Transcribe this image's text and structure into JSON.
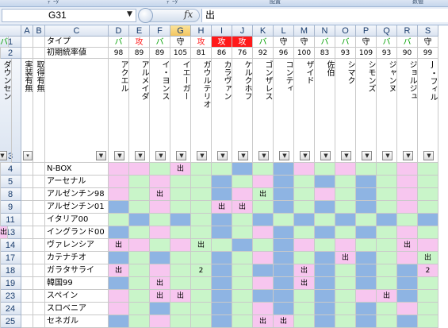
{
  "colors": {
    "red": "#ff1a1a",
    "orange": "#ff7a00",
    "green": "#00a000",
    "pink": "#f7c6ef",
    "lgreen": "#c9f5c9",
    "blue": "#8eb4e3"
  },
  "ribbon": {
    "labels": [
      "ﾃﾞｰﾀ",
      "ﾃﾞｰﾀ",
      "配置",
      "数値"
    ]
  },
  "formula_bar": {
    "name_box": "G31",
    "fx": "fx",
    "value": "出"
  },
  "columns": [
    "A",
    "B",
    "C",
    "D",
    "E",
    "F",
    "G",
    "H",
    "I",
    "J",
    "K",
    "L",
    "M",
    "N",
    "O",
    "P",
    "Q",
    "R",
    "S"
  ],
  "selected_column": "G",
  "header": {
    "row1_label": "タイプ",
    "row2_label": "初期統率値",
    "a3_label": "実装有無",
    "b3_label": "取得有無",
    "players": [
      {
        "name": "アクエル",
        "type": "バ",
        "val": "98",
        "style": "green"
      },
      {
        "name": "アルメイダ",
        "type": "攻",
        "val": "89",
        "style": "red"
      },
      {
        "name": "イ・ヨンス",
        "type": "バ",
        "val": "89",
        "style": "green"
      },
      {
        "name": "イエーガー",
        "type": "守",
        "val": "105",
        "style": "plain"
      },
      {
        "name": "ガウルテリオ",
        "type": "攻",
        "val": "81",
        "style": "red"
      },
      {
        "name": "カラヴァン",
        "type": "攻",
        "val": "86",
        "style": "redbg"
      },
      {
        "name": "ケルクホフ",
        "type": "攻",
        "val": "76",
        "style": "redbg"
      },
      {
        "name": "ゴンザレス",
        "type": "バ",
        "val": "92",
        "style": "green"
      },
      {
        "name": "コンティ",
        "type": "守",
        "val": "96",
        "style": "plain"
      },
      {
        "name": "ザイド",
        "type": "守",
        "val": "100",
        "style": "plain"
      },
      {
        "name": "佐伯",
        "type": "バ",
        "val": "83",
        "style": "green"
      },
      {
        "name": "シマク",
        "type": "バ",
        "val": "93",
        "style": "green"
      },
      {
        "name": "シモンズ",
        "type": "守",
        "val": "109",
        "style": "plain"
      },
      {
        "name": "ジャンヌ",
        "type": "バ",
        "val": "93",
        "style": "green"
      },
      {
        "name": "ジョルジュ",
        "type": "バ",
        "val": "90",
        "style": "green"
      },
      {
        "name": "J・フィル",
        "type": "守",
        "val": "99",
        "style": "plain"
      },
      {
        "name": "ダウンセン",
        "type": "バ",
        "val": "",
        "style": "green"
      }
    ]
  },
  "rows": [
    {
      "num": "4",
      "team": "N-BOX"
    },
    {
      "num": "5",
      "team": "アーセナル"
    },
    {
      "num": "8",
      "team": "アルゼンチン98"
    },
    {
      "num": "9",
      "team": "アルゼンチン01"
    },
    {
      "num": "11",
      "team": "イタリア00"
    },
    {
      "num": "13",
      "team": "イングランド00"
    },
    {
      "num": "14",
      "team": "ヴァレンシア"
    },
    {
      "num": "17",
      "team": "カテナチオ"
    },
    {
      "num": "18",
      "team": "ガラタサライ"
    },
    {
      "num": "19",
      "team": "韓国99"
    },
    {
      "num": "23",
      "team": "スペイン"
    },
    {
      "num": "24",
      "team": "スロベニア"
    },
    {
      "num": "25",
      "team": "セネガル"
    }
  ],
  "cells": [
    "ppgpggbgbpgpggpgp",
    "pgpggbgpbgbgbgpgb",
    "pgpggbpgbgpgbgpgb",
    "bgpggppgbgbgbgpgb",
    "gbgbgbgbgbgbgbgbg",
    "bgpggbgpbgbgbgpgp",
    "ppgpggbgbpgpggppg",
    "bgbggbgpbgbpbgpgb",
    "pgpggbgbbpbgbgbpg",
    "bgpggbgpbpbgbgbgb",
    "pgppgbgbbgbgppbgb",
    "pgbggbgpbgbgbgpgb",
    "bgpggbgppgbgbgbgb"
  ],
  "marks": {
    "0-3": "出",
    "2-2": "出",
    "2-7": "出",
    "3-5": "出",
    "3-6": "出",
    "5-16": "出",
    "6-0": "出",
    "6-4": "出",
    "6-14": "出",
    "7-11": "出",
    "7-15": "出",
    "8-0": "出",
    "8-4": "2",
    "8-9": "出",
    "8-15": "2",
    "9-2": "出",
    "9-9": "出",
    "10-2": "出",
    "10-3": "出",
    "10-13": "出",
    "12-7": "出",
    "12-8": "出"
  }
}
